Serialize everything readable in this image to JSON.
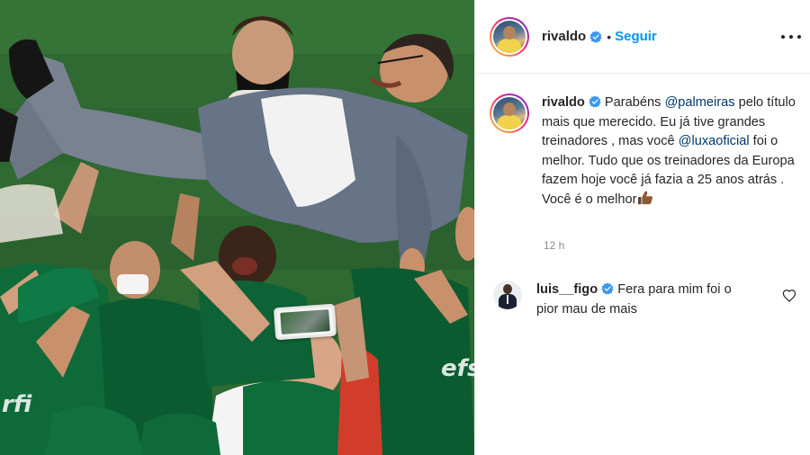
{
  "post": {
    "author": {
      "username": "rivaldo",
      "verified": true,
      "follow_label": "Seguir",
      "separator": "•"
    },
    "menu_icon": "more-options-icon",
    "caption": {
      "username": "rivaldo",
      "parts": {
        "t1": "Parabéns ",
        "m1": "@palmeiras",
        "t2": " pelo título mais que merecido. Eu já tive grandes treinadores , mas você ",
        "m2": "@luxaoficial",
        "t3": " foi o melhor. Tudo que os treinadores da Europa fazem hoje você já fazia a 25 anos atrás . Você é o melhor"
      },
      "emoji": "thumbs-up-emoji",
      "time": "12 h"
    },
    "comments": [
      {
        "username": "luis__figo",
        "verified": true,
        "text": "Fera para mim foi o pior mau de mais",
        "like_icon": "heart-icon"
      }
    ],
    "colors": {
      "link": "#0095f6",
      "mention": "#00376b",
      "verified": "#3897f0",
      "muted": "#8e8e8e"
    }
  }
}
